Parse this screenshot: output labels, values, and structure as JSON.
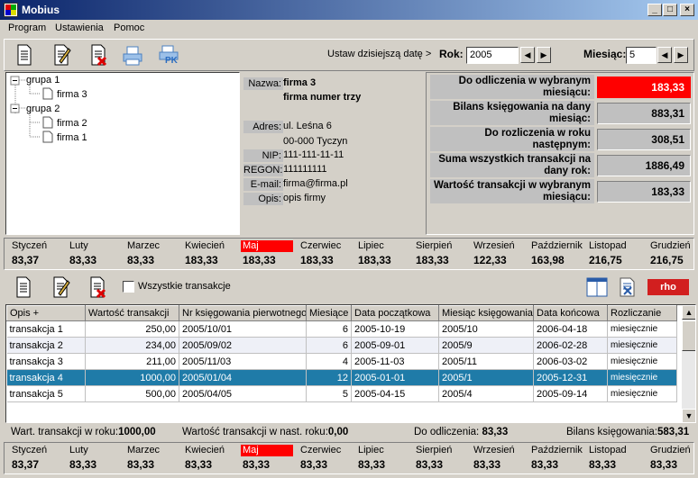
{
  "window": {
    "title": "Mobius"
  },
  "menu": [
    "Program",
    "Ustawienia",
    "Pomoc"
  ],
  "toolbar": {
    "set_today": "Ustaw dzisiejszą datę >",
    "year_label": "Rok:",
    "year_value": "2005",
    "month_label": "Miesiąc:",
    "month_value": "5",
    "pk_label": "PK"
  },
  "tree": {
    "groups": [
      {
        "label": "grupa 1",
        "children": [
          "firma 3"
        ]
      },
      {
        "label": "grupa 2",
        "children": [
          "firma 2",
          "firma 1"
        ]
      }
    ]
  },
  "details": {
    "name_label": "Nazwa:",
    "name": "firma 3",
    "full_name": "firma numer trzy",
    "address_label": "Adres:",
    "address1": "ul. Leśna 6",
    "address2": "00-000 Tyczyn",
    "nip_label": "NIP:",
    "nip": "111-111-11-11",
    "regon_label": "REGON:",
    "regon": "111111111",
    "email_label": "E-mail:",
    "email": "firma@firma.pl",
    "desc_label": "Opis:",
    "desc": "opis firmy"
  },
  "summary": [
    {
      "label": "Do odliczenia w wybranym miesiącu:",
      "value": "183,33",
      "highlight": true
    },
    {
      "label": "Bilans księgowania na dany miesiąc:",
      "value": "883,31"
    },
    {
      "label": "Do rozliczenia w roku następnym:",
      "value": "308,51"
    },
    {
      "label": "Suma wszystkich transakcji na dany rok:",
      "value": "1886,49"
    },
    {
      "label": "Wartość transakcji w wybranym miesiącu:",
      "value": "183,33"
    }
  ],
  "months_top": [
    {
      "name": "Styczeń",
      "value": "83,37"
    },
    {
      "name": "Luty",
      "value": "83,33"
    },
    {
      "name": "Marzec",
      "value": "83,33"
    },
    {
      "name": "Kwiecień",
      "value": "183,33"
    },
    {
      "name": "Maj",
      "value": "183,33",
      "selected": true
    },
    {
      "name": "Czerwiec",
      "value": "183,33"
    },
    {
      "name": "Lipiec",
      "value": "183,33"
    },
    {
      "name": "Sierpień",
      "value": "183,33"
    },
    {
      "name": "Wrzesień",
      "value": "122,33"
    },
    {
      "name": "Październik",
      "value": "163,98"
    },
    {
      "name": "Listopad",
      "value": "216,75"
    },
    {
      "name": "Grudzień",
      "value": "216,75"
    }
  ],
  "transactions_toolbar": {
    "all_label": "Wszystkie transakcje",
    "all_checked": false,
    "logo_text": "rho"
  },
  "table": {
    "columns": [
      "Opis +",
      "Wartość transakcji",
      "Nr księgowania pierwotnego",
      "Miesiące",
      "Data początkowa",
      "Miesiąc księgowania",
      "Data końcowa",
      "Rozliczanie"
    ],
    "rows": [
      [
        "transakcja 1",
        "250,00",
        "2005/10/01",
        "6",
        "2005-10-19",
        "2005/10",
        "2006-04-18",
        "miesięcznie"
      ],
      [
        "transakcja 2",
        "234,00",
        "2005/09/02",
        "6",
        "2005-09-01",
        "2005/9",
        "2006-02-28",
        "miesięcznie"
      ],
      [
        "transakcja 3",
        "211,00",
        "2005/11/03",
        "4",
        "2005-11-03",
        "2005/11",
        "2006-03-02",
        "miesięcznie"
      ],
      [
        "transakcja 4",
        "1000,00",
        "2005/01/04",
        "12",
        "2005-01-01",
        "2005/1",
        "2005-12-31",
        "miesięcznie"
      ],
      [
        "transakcja 5",
        "500,00",
        "2005/04/05",
        "5",
        "2005-04-15",
        "2005/4",
        "2005-09-14",
        "miesięcznie"
      ]
    ],
    "selected_row": 3
  },
  "status": {
    "year_label": "Wart. transakcji w roku:",
    "year_value": "1000,00",
    "next_label": "Wartość transakcji w nast. roku:",
    "next_value": "0,00",
    "deduct_label": "Do odliczenia:",
    "deduct_value": "83,33",
    "balance_label": "Bilans księgowania:",
    "balance_value": "583,31"
  },
  "months_bottom": [
    {
      "name": "Styczeń",
      "value": "83,37"
    },
    {
      "name": "Luty",
      "value": "83,33"
    },
    {
      "name": "Marzec",
      "value": "83,33"
    },
    {
      "name": "Kwiecień",
      "value": "83,33"
    },
    {
      "name": "Maj",
      "value": "83,33",
      "selected": true
    },
    {
      "name": "Czerwiec",
      "value": "83,33"
    },
    {
      "name": "Lipiec",
      "value": "83,33"
    },
    {
      "name": "Sierpień",
      "value": "83,33"
    },
    {
      "name": "Wrzesień",
      "value": "83,33"
    },
    {
      "name": "Październik",
      "value": "83,33"
    },
    {
      "name": "Listopad",
      "value": "83,33"
    },
    {
      "name": "Grudzień",
      "value": "83,33"
    }
  ],
  "colors": {
    "titlebar": "#0a246a",
    "highlight_red": "#ff0000",
    "selected_row": "#1f7ba8"
  }
}
